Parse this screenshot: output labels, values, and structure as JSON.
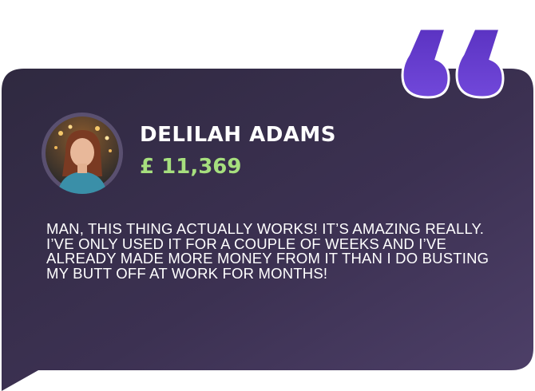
{
  "testimonial": {
    "name": "DELILAH ADAMS",
    "amount": "£ 11,369",
    "text": "MAN, THIS THING ACTUALLY WORKS! IT’S AMAZING REALLY. I’VE ONLY USED IT FOR A COUPLE OF WEEKS AND I’VE ALREADY MADE MORE MONEY FROM IT THAN I DO BUSTING MY BUTT OFF AT WORK FOR MONTHS!"
  },
  "colors": {
    "bubble_dark": "#2f2940",
    "bubble_light": "#4d4067",
    "quote_accent": "#6a3fd0",
    "amount_green": "#a6df7e",
    "avatar_ring": "#5a5070"
  },
  "icons": {
    "quote": "quote-mark-icon",
    "avatar": "user-avatar-photo"
  }
}
